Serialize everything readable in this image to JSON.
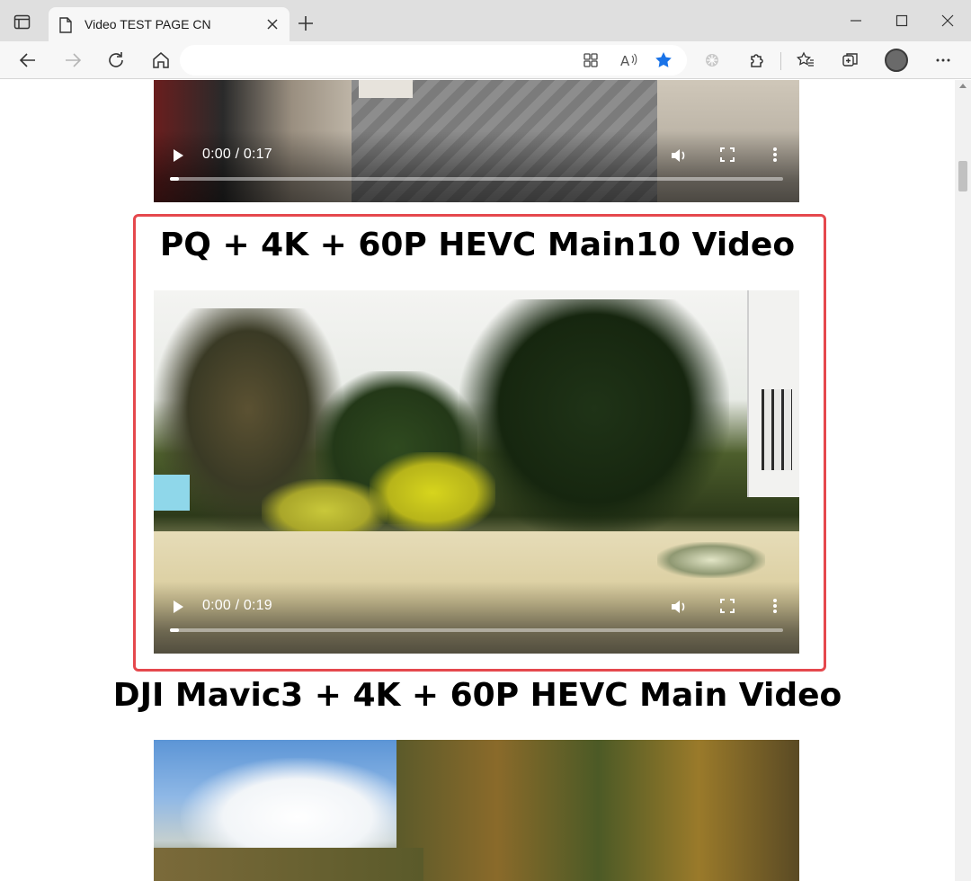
{
  "browser": {
    "tab_title": "Video TEST PAGE CN",
    "address_url": ""
  },
  "page": {
    "sections": [
      {
        "title": "",
        "time": "0:00 / 0:17"
      },
      {
        "title": "PQ + 4K + 60P HEVC Main10 Video",
        "time": "0:00 / 0:19"
      },
      {
        "title": "DJI Mavic3 + 4K + 60P HEVC Main Video",
        "time": ""
      }
    ]
  },
  "colors": {
    "highlight": "#e5484d",
    "favorite_star": "#1a73e8"
  },
  "icons": [
    "tab-actions-icon",
    "page-icon",
    "close-icon",
    "plus-icon",
    "minimize-icon",
    "maximize-icon",
    "back-icon",
    "forward-icon",
    "refresh-icon",
    "home-icon",
    "apps-icon",
    "read-aloud-icon",
    "star-icon",
    "extension-icon",
    "puzzle-icon",
    "favorites-icon",
    "collections-icon",
    "more-icon",
    "play-icon",
    "volume-icon",
    "fullscreen-icon"
  ]
}
